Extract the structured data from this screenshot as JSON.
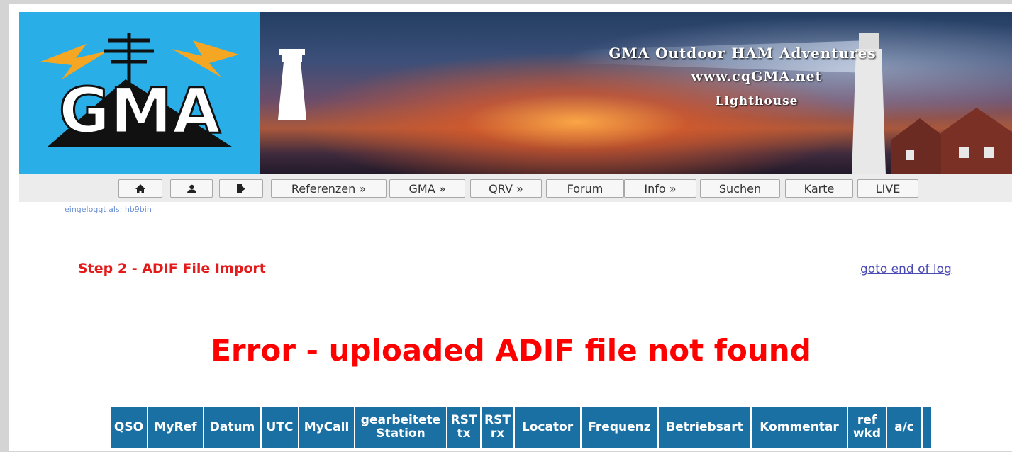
{
  "banner": {
    "logo_text": "GMA",
    "title": "GMA Outdoor HAM Adventures",
    "url": "www.cqGMA.net",
    "subtitle": "Lighthouse"
  },
  "nav": {
    "home_icon": "home-icon",
    "user_icon": "user-icon",
    "logout_icon": "logout-icon",
    "items": [
      {
        "label": "Referenzen »"
      },
      {
        "label": "GMA »"
      },
      {
        "label": "QRV »"
      },
      {
        "label": "Forum"
      },
      {
        "label": "Info »"
      },
      {
        "label": "Suchen"
      },
      {
        "label": "Karte"
      },
      {
        "label": "LIVE"
      }
    ]
  },
  "login_status": "eingeloggt als: hb9bin",
  "step_title": "Step 2 - ADIF File Import",
  "goto_link": "goto end of log",
  "error_message": "Error - uploaded ADIF file not found",
  "table": {
    "columns": [
      {
        "label": "QSO"
      },
      {
        "label": "MyRef"
      },
      {
        "label": "Datum"
      },
      {
        "label": "UTC"
      },
      {
        "label": "MyCall"
      },
      {
        "label": "gearbeitete Station"
      },
      {
        "label": "RST tx"
      },
      {
        "label": "RST rx"
      },
      {
        "label": "Locator"
      },
      {
        "label": "Frequenz"
      },
      {
        "label": "Betriebsart"
      },
      {
        "label": "Kommentar"
      },
      {
        "label": "ref wkd"
      },
      {
        "label": "a/c"
      },
      {
        "label": ""
      }
    ]
  },
  "colors": {
    "accent_red": "#e41b1b",
    "error_red": "#ff0000",
    "table_header_blue": "#1a6fa3",
    "logo_blue": "#2aaee7"
  }
}
